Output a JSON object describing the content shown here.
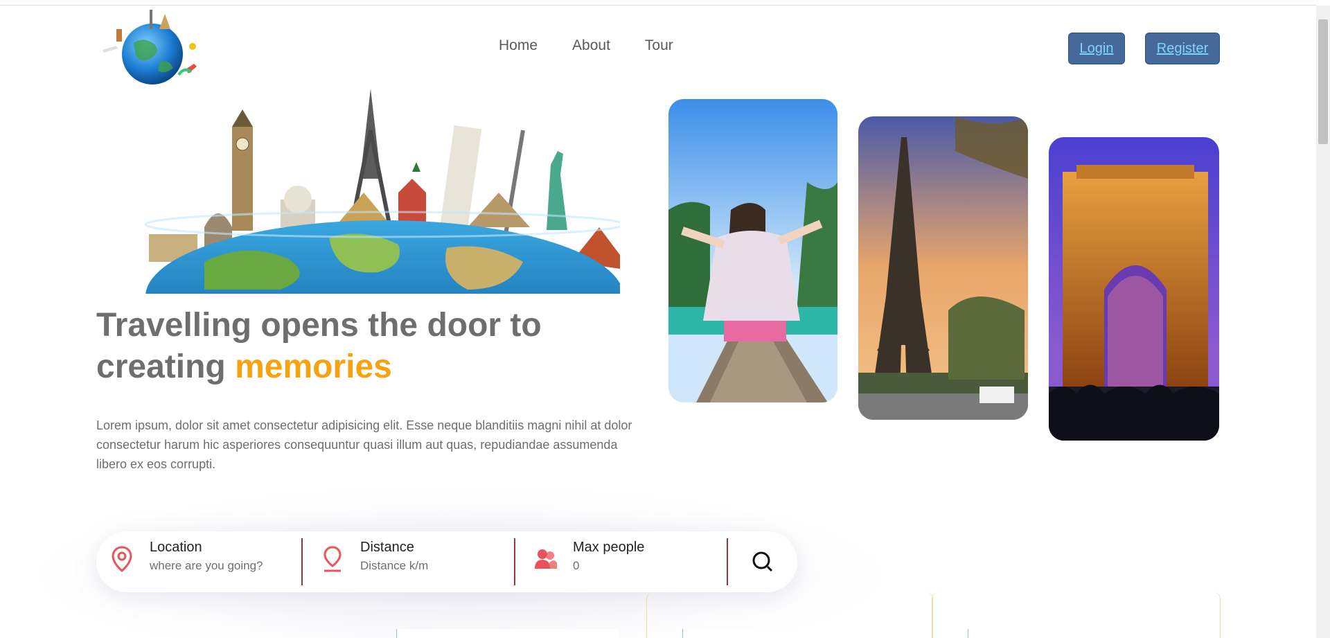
{
  "nav": {
    "home": "Home",
    "about": "About",
    "tour": "Tour"
  },
  "auth": {
    "login": "Login",
    "register": "Register"
  },
  "hero": {
    "headline_main": "Travelling opens the door to creating ",
    "headline_accent": "memories",
    "description": "Lorem ipsum, dolor sit amet consectetur adipisicing elit. Esse neque blanditiis magni nihil at dolor consectetur harum hic asperiores consequuntur quasi illum aut quas, repudiandae assumenda libero ex eos corrupti."
  },
  "search": {
    "location_label": "Location",
    "location_placeholder": "where are you going?",
    "distance_label": "Distance",
    "distance_placeholder": "Distance k/m",
    "people_label": "Max people",
    "people_placeholder": "0"
  },
  "colors": {
    "accent": "#f5a310",
    "icon_red": "#e8545a",
    "button_bg": "#45699a",
    "button_text": "#7fd4ff",
    "heading": "#6e6e6e"
  },
  "icons": {
    "location": "map-pin-icon",
    "distance": "pin-drop-icon",
    "people": "users-icon",
    "search": "search-icon"
  }
}
